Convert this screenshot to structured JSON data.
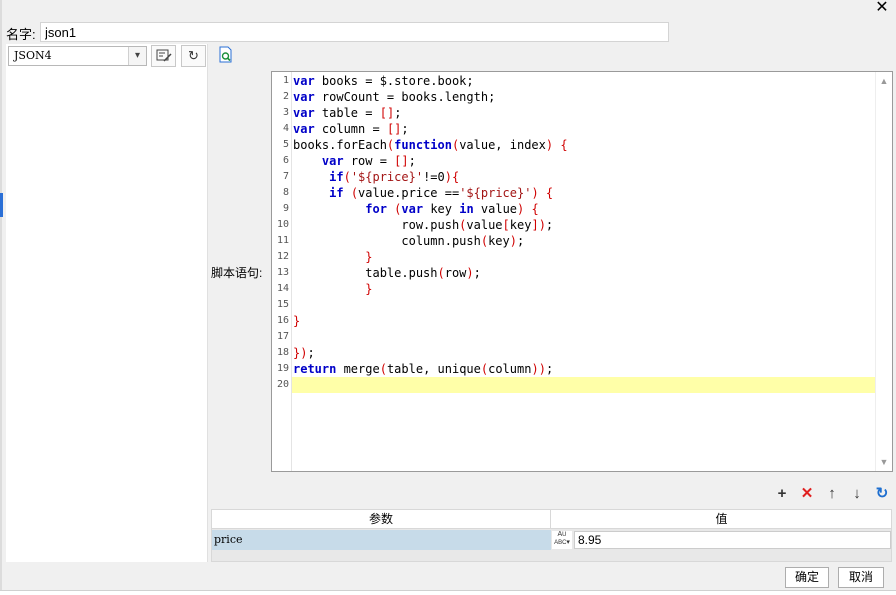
{
  "window": {
    "close_glyph": "✕"
  },
  "name_field": {
    "label": "名字:",
    "value": "json1"
  },
  "datasource": {
    "selected": "JSON4"
  },
  "toolbar": {
    "edit_icon": "edit-dataset-icon",
    "refresh_icon": "refresh-icon",
    "preview_icon": "preview-icon"
  },
  "script": {
    "label": "脚本语句:",
    "active_line": 20,
    "lines": [
      "var books = $.store.book;",
      "var rowCount = books.length;",
      "var table = [];",
      "var column = [];",
      "books.forEach(function(value, index) {",
      "    var row = [];",
      "     if('${price}'!=0){",
      "     if (value.price =='${price}') {",
      "          for (var key in value) {",
      "               row.push(value[key]);",
      "               column.push(key);",
      "          }",
      "          table.push(row);",
      "          }",
      "",
      "}",
      "",
      "});",
      "return merge(table, unique(column));",
      ""
    ]
  },
  "param_tools": {
    "add": "+",
    "delete": "✕",
    "move_up": "↑",
    "move_down": "↓",
    "refresh": "↻"
  },
  "param_table": {
    "headers": [
      "参数",
      "值"
    ],
    "rows": [
      {
        "name": "price",
        "type_icon": "ABC",
        "value": "8.95"
      }
    ]
  },
  "dialog_buttons": {
    "ok": "确定",
    "cancel": "取消"
  }
}
